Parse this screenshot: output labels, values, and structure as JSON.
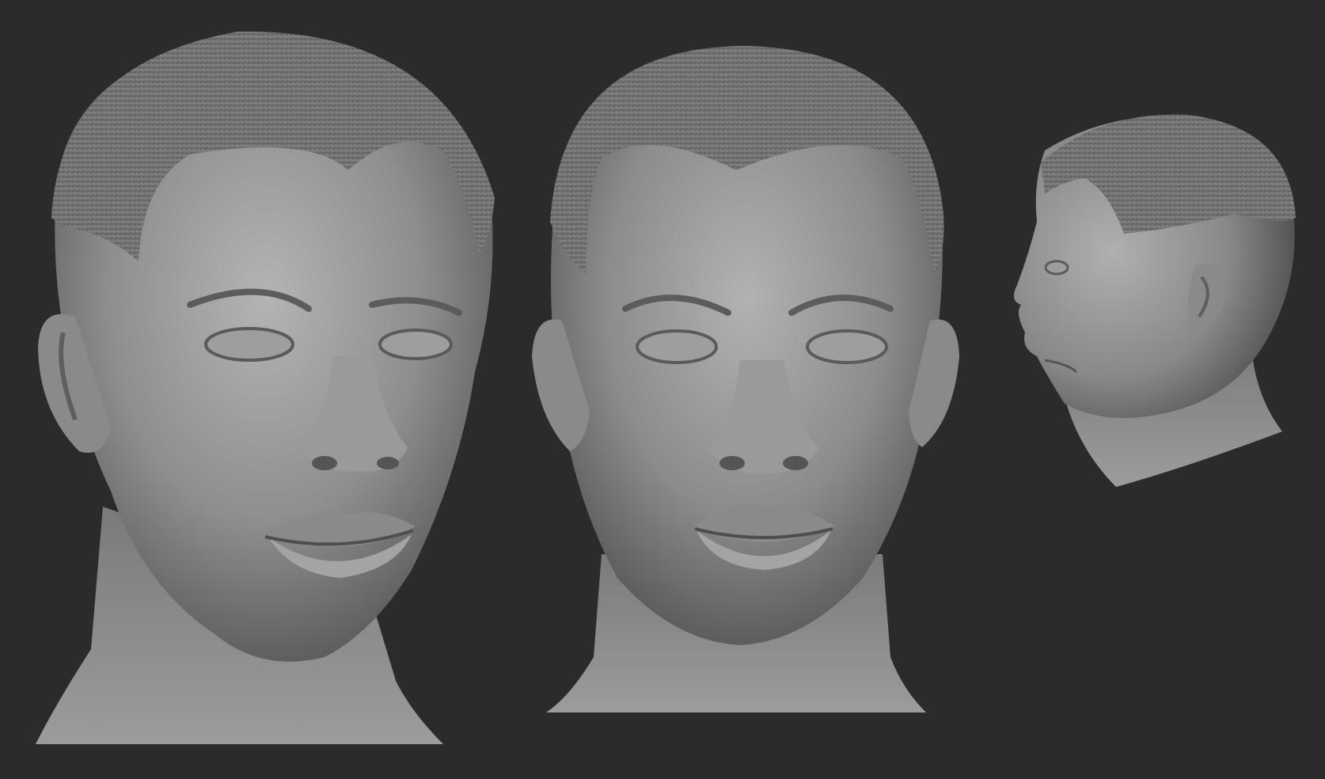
{
  "scene": {
    "background_color": "#2b2b2b",
    "material_color": "#a6a6a6",
    "views": [
      {
        "name": "three-quarter-view",
        "description_icon": "sculpt-head-icon"
      },
      {
        "name": "front-view",
        "description_icon": "sculpt-head-icon"
      },
      {
        "name": "side-profile-view",
        "description_icon": "sculpt-head-icon"
      }
    ]
  }
}
